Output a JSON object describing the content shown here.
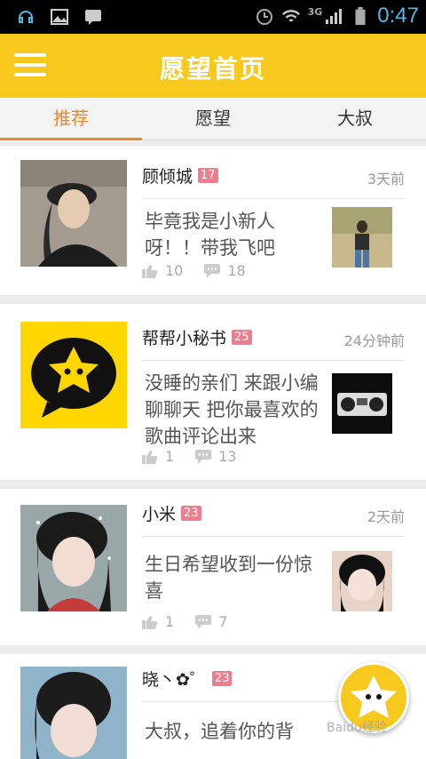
{
  "status_bar": {
    "time": "0:47",
    "network": "3G"
  },
  "app_bar": {
    "title": "愿望首页"
  },
  "tabs": [
    {
      "label": "推荐",
      "active": true
    },
    {
      "label": "愿望",
      "active": false
    },
    {
      "label": "大叔",
      "active": false
    }
  ],
  "posts": [
    {
      "name": "顾倾城",
      "age": "17",
      "time": "3天前",
      "text": "毕竟我是小新人呀！！带我飞吧",
      "likes": "10",
      "comments": "18"
    },
    {
      "name": "帮帮小秘书",
      "age": "25",
      "time": "24分钟前",
      "text": "没睡的亲们 来跟小编聊聊天 把你最喜欢的歌曲评论出来",
      "likes": "1",
      "comments": "13"
    },
    {
      "name": "小米",
      "age": "23",
      "time": "2天前",
      "text": "生日希望收到一份惊喜",
      "likes": "1",
      "comments": "7"
    },
    {
      "name": "晓丶✿゜",
      "age": "23",
      "time": "",
      "text": "大叔，追着你的背",
      "likes": "",
      "comments": ""
    }
  ],
  "watermark": "Baidu经验",
  "colors": {
    "brand_yellow": "#f7c81e",
    "tab_active": "#e98a2a",
    "age_badge": "#f07c8e",
    "status_text": "#4fb8e6"
  },
  "icons": [
    "menu-icon",
    "like-icon",
    "comment-icon",
    "star-mascot-icon",
    "wifi-icon",
    "signal-icon",
    "battery-icon",
    "alarm-icon"
  ]
}
